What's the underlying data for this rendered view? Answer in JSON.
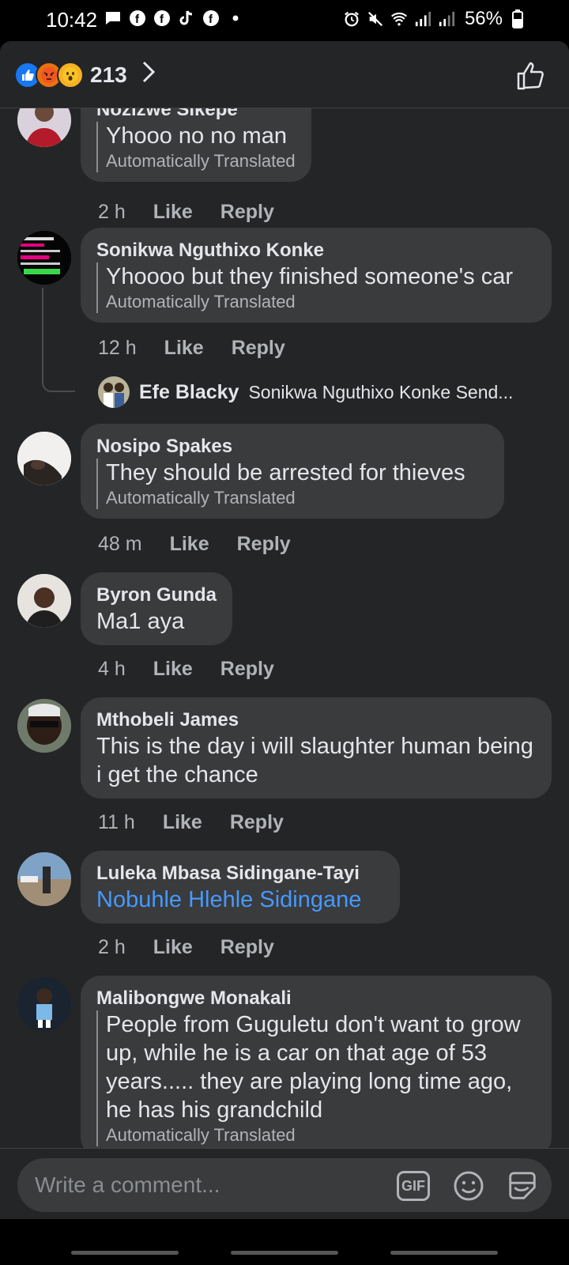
{
  "status_bar": {
    "time": "10:42",
    "battery": "56%"
  },
  "header": {
    "reaction_count": "213",
    "chevron": ">"
  },
  "comments": [
    {
      "author": "Nozizwe Sikepe",
      "text": "Yhooo no no man",
      "translated": "Automatically Translated",
      "time": "2 h",
      "like": "Like",
      "reply": "Reply"
    },
    {
      "author": "Sonikwa Nguthixo Konke",
      "text": "Yhoooo but they finished someone's car",
      "translated": "Automatically Translated",
      "time": "12 h",
      "like": "Like",
      "reply": "Reply",
      "reply_preview": {
        "author": "Efe Blacky",
        "text": "Sonikwa Nguthixo Konke Send..."
      }
    },
    {
      "author": "Nosipo Spakes",
      "text": "They should be arrested for thieves",
      "translated": "Automatically Translated",
      "time": "48 m",
      "like": "Like",
      "reply": "Reply"
    },
    {
      "author": "Byron Gunda",
      "text": "Ma1 aya",
      "time": "4 h",
      "like": "Like",
      "reply": "Reply"
    },
    {
      "author": "Mthobeli James",
      "text": "This is the day i will slaughter human being i get the chance",
      "time": "11 h",
      "like": "Like",
      "reply": "Reply"
    },
    {
      "author": "Luleka Mbasa Sidingane-Tayi",
      "text": "Nobuhle Hlehle Sidingane",
      "time": "2 h",
      "like": "Like",
      "reply": "Reply"
    },
    {
      "author": "Malibongwe Monakali",
      "text": "People from Guguletu don't want to grow up, while he is a car on that age of 53 years..... they are playing long time ago, he has his grandchild",
      "translated": "Automatically Translated"
    }
  ],
  "composer": {
    "placeholder": "Write a comment...",
    "gif_label": "GIF"
  },
  "colors": {
    "background": "#242526",
    "bubble": "#3a3b3c",
    "link": "#4599ff",
    "like_blue": "#1877f2"
  },
  "icons": [
    "like-reaction-icon",
    "angry-reaction-icon",
    "wow-reaction-icon",
    "thumbs-up-icon",
    "gif-icon",
    "emoji-icon",
    "sticker-icon"
  ]
}
